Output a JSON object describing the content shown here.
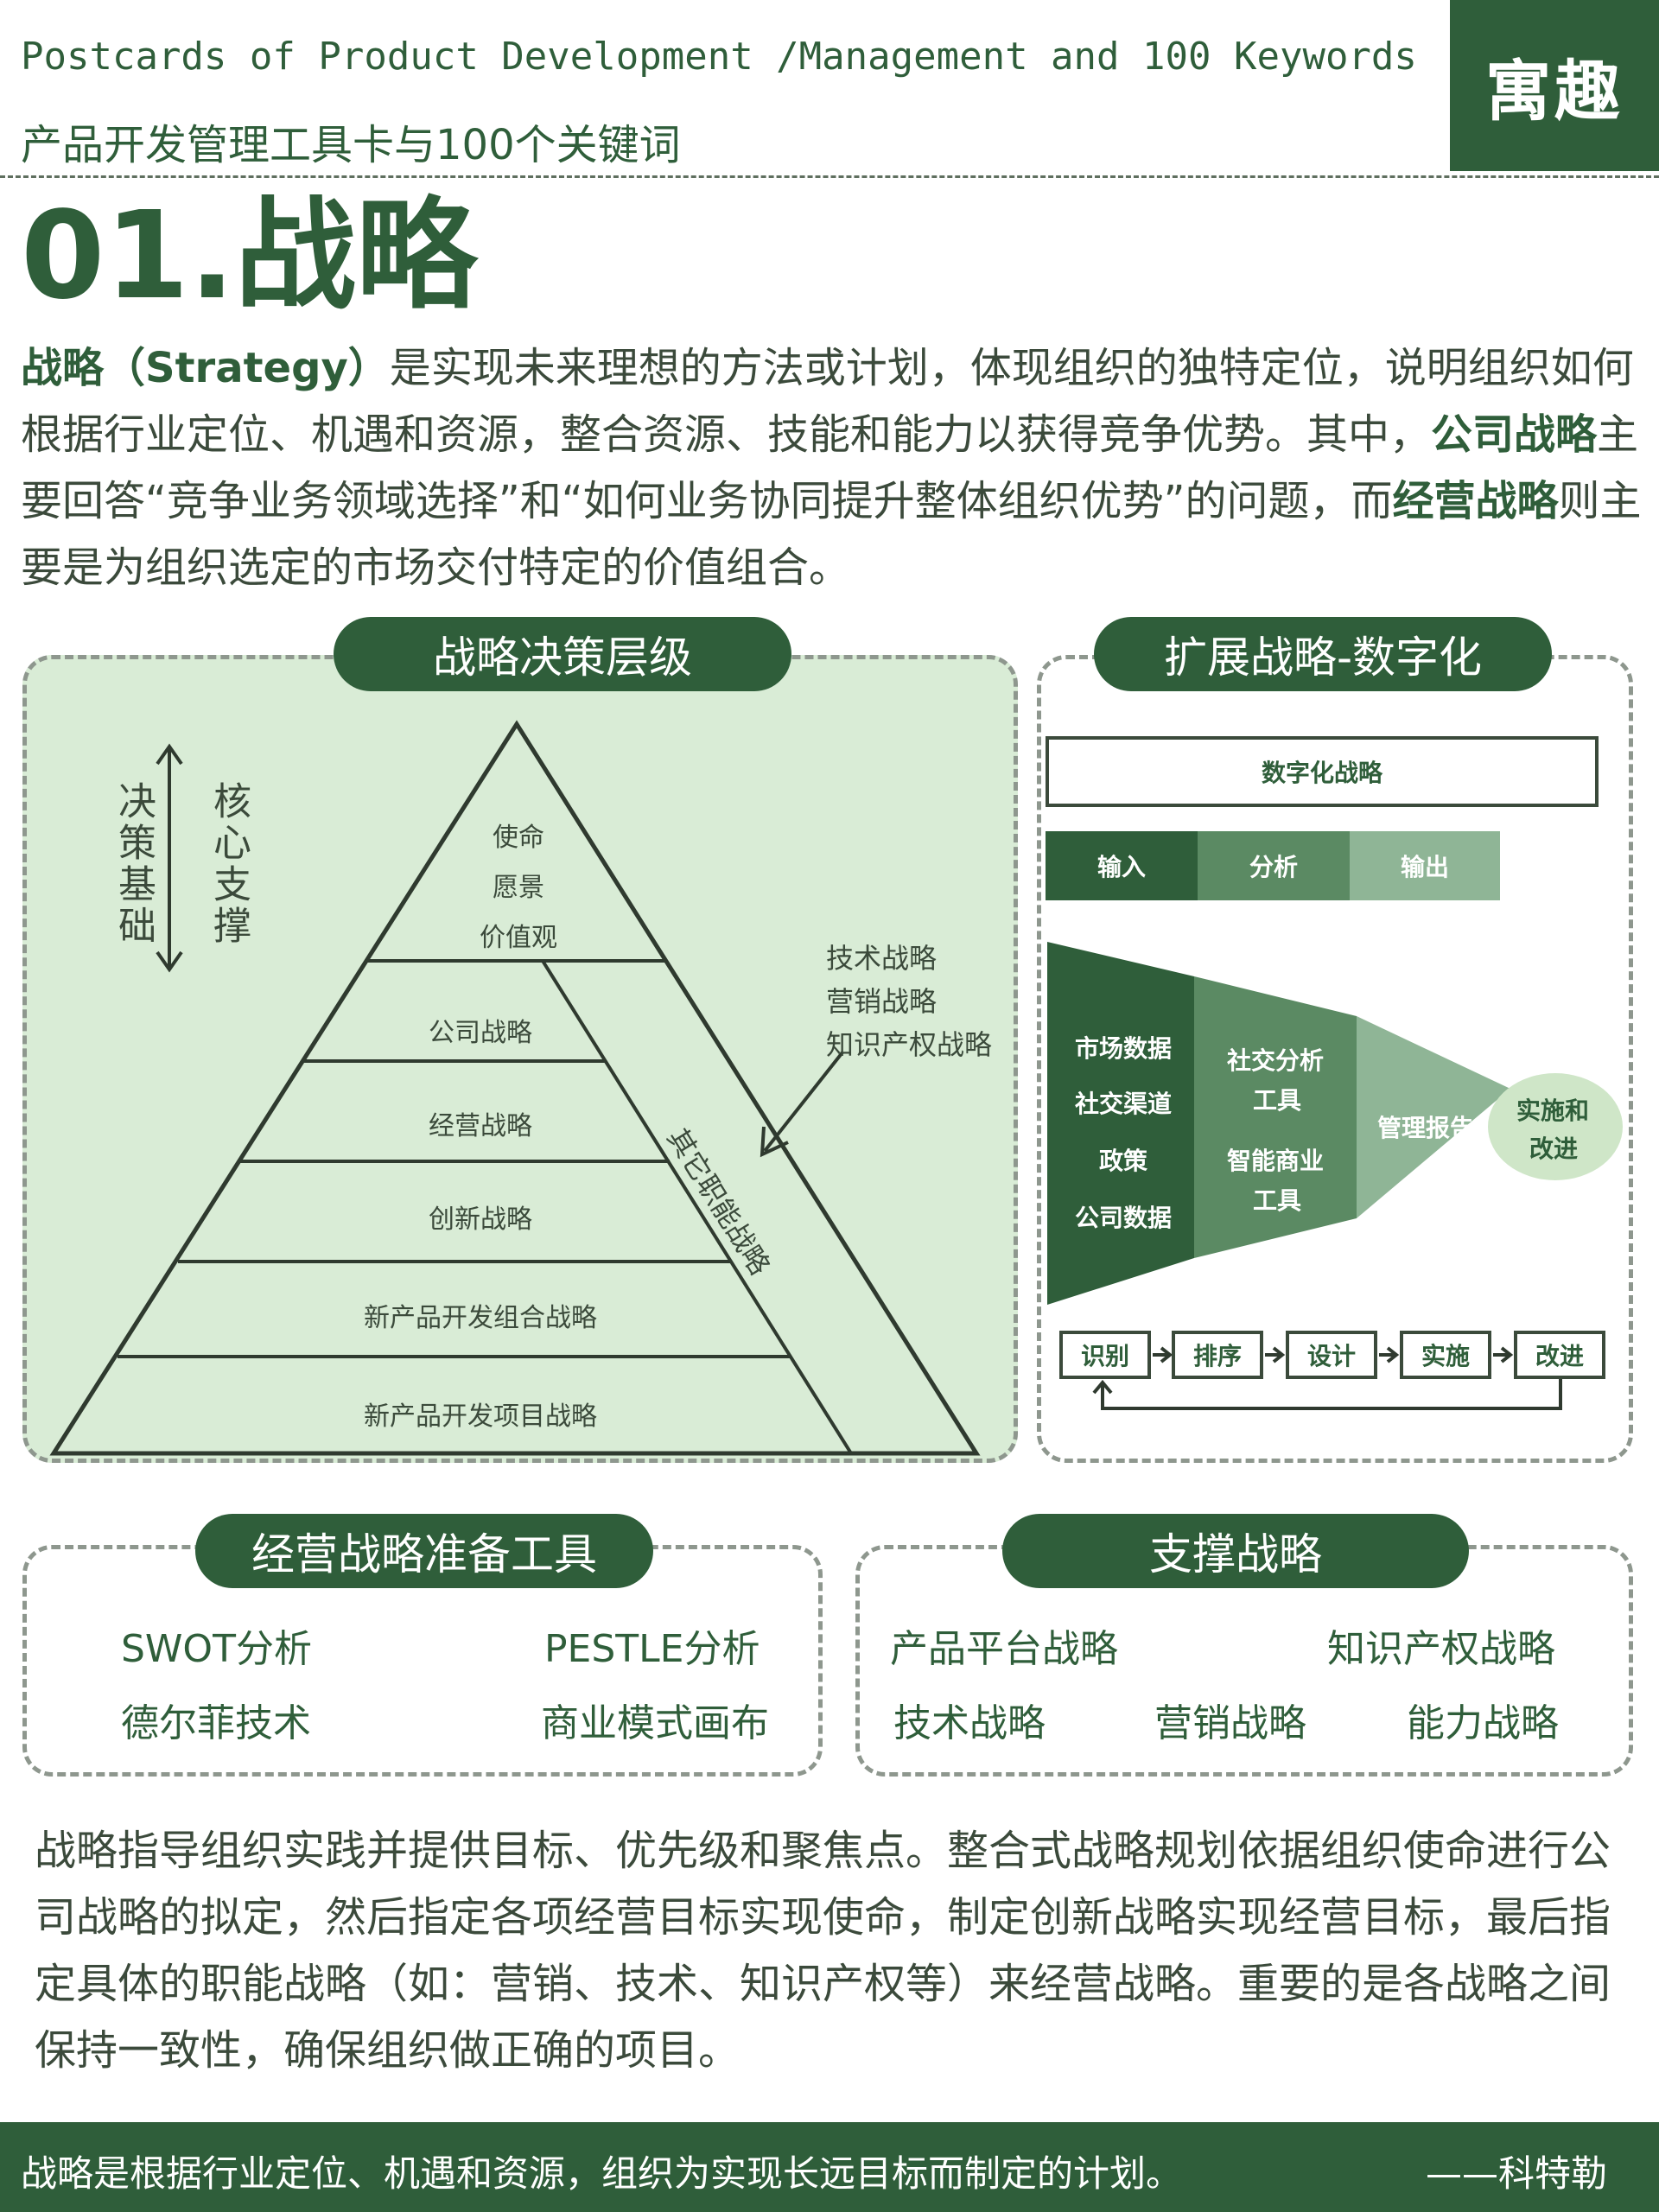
{
  "header": {
    "title_en": "Postcards of Product Development /Management and 100 Keywords",
    "title_cn": "产品开发管理工具卡与100个关键词",
    "brand": "寓趣"
  },
  "section_title": "01.战略",
  "intro": {
    "term": "战略",
    "term_en": "（Strategy）",
    "part1": "是实现未来理想的方法或计划，体现组织的独特定位，说明组织如何根据行业定位、机遇和资源，整合资源、技能和能力以获得竞争优势。其中，",
    "corp_term": "公司战略",
    "part2": "主要回答“竞争业务领域选择”和“如何业务协同提升整体组织优势”的问题，而",
    "biz_term": "经营战略",
    "part3": "则主要是为组织选定的市场交付特定的价值组合。"
  },
  "hierarchy": {
    "title": "战略决策层级",
    "left_label": "决策基础",
    "right_label": "核心支撑",
    "levels": [
      "使命",
      "愿景",
      "价值观",
      "公司战略",
      "经营战略",
      "创新战略",
      "新产品开发组合战略",
      "新产品开发项目战略"
    ],
    "functional_label": "其它职能战略",
    "functional_examples": [
      "技术战略",
      "营销战略",
      "知识产权战略"
    ]
  },
  "digital": {
    "title": "扩展战略-数字化",
    "box": "数字化战略",
    "io": [
      "输入",
      "分析",
      "输出"
    ],
    "inputs": [
      "市场数据",
      "社交渠道",
      "政策",
      "公司数据"
    ],
    "analysis_1": "社交分析",
    "analysis_1b": "工具",
    "analysis_2": "智能商业",
    "analysis_2b": "工具",
    "output": "管理报告",
    "result_1": "实施和",
    "result_2": "改进",
    "steps": [
      "识别",
      "排序",
      "设计",
      "实施",
      "改进"
    ]
  },
  "tools": {
    "title": "经营战略准备工具",
    "items": [
      "SWOT分析",
      "PESTLE分析",
      "德尔菲技术",
      "商业模式画布"
    ]
  },
  "support": {
    "title": "支撑战略",
    "items": [
      "产品平台战略",
      "知识产权战略",
      "技术战略",
      "营销战略",
      "能力战略"
    ]
  },
  "summary": "战略指导组织实践并提供目标、优先级和聚焦点。整合式战略规划依据组织使命进行公司战略的拟定，然后指定各项经营目标实现使命，制定创新战略实现经营目标，最后指定具体的职能战略（如：营销、技术、知识产权等）来经营战略。重要的是各战略之间保持一致性，确保组织做正确的项目。",
  "footer": {
    "quote": "战略是根据行业定位、机遇和资源，组织为实现长远目标而制定的计划。",
    "author": "——科特勒"
  },
  "colors": {
    "primary": "#2f5e3a",
    "light_green": "#d9ecd6",
    "mid_green": "#5b8a63",
    "pale_green": "#8fb596",
    "circle": "#cfe6c8"
  }
}
